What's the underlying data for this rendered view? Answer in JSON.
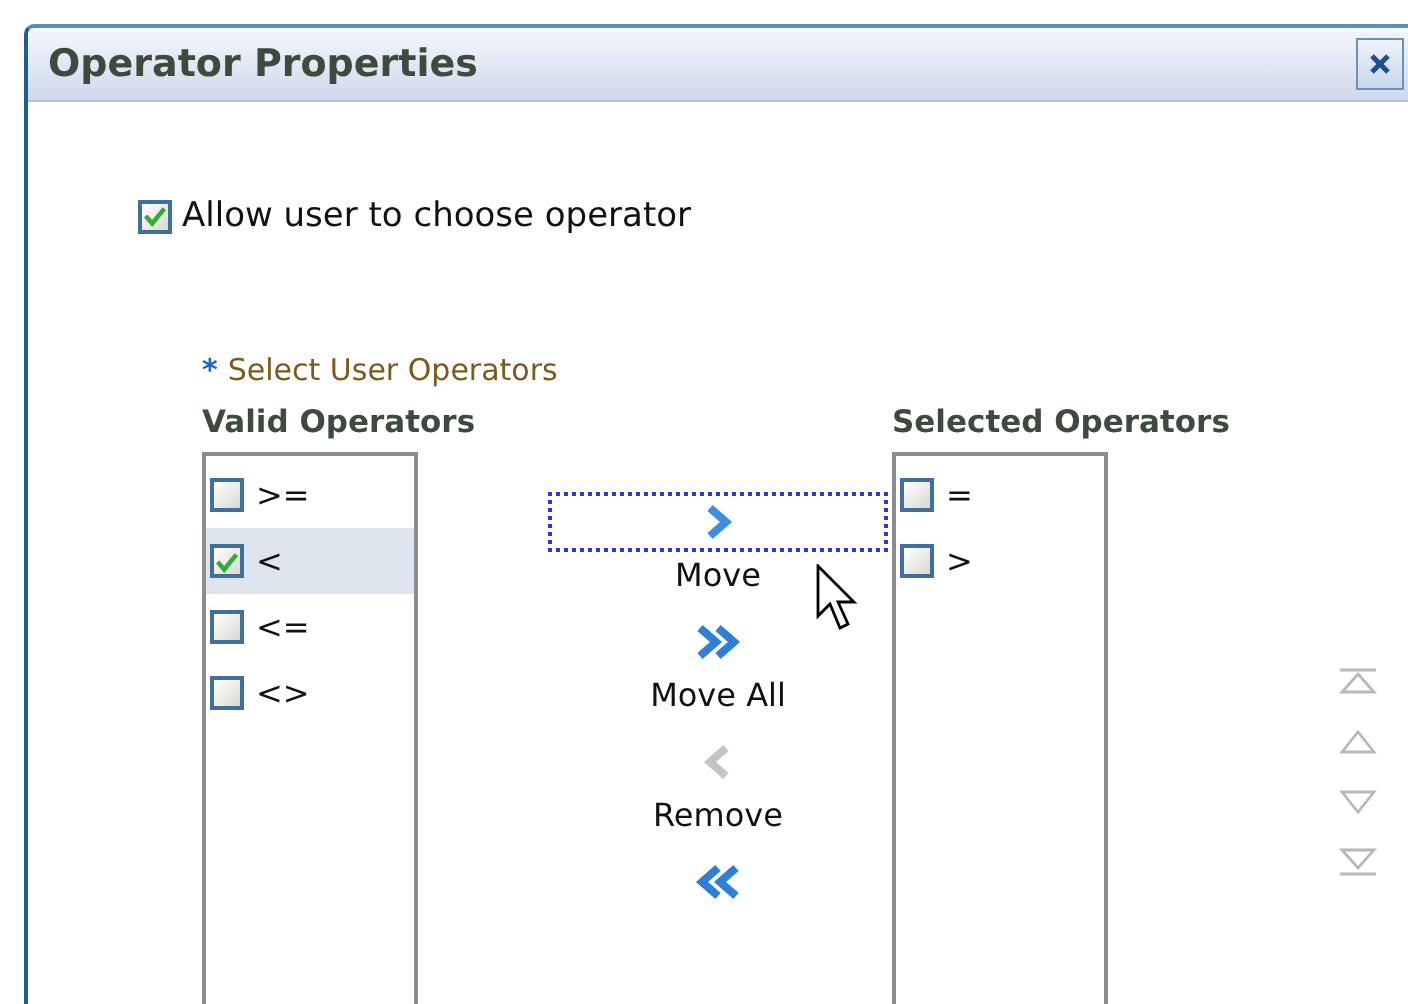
{
  "window": {
    "title": "Operator Properties"
  },
  "allow_choose": {
    "label": "Allow user to choose operator",
    "checked": true
  },
  "required_label": {
    "marker": "*",
    "text": "Select User Operators"
  },
  "valid_operators": {
    "heading": "Valid Operators",
    "items": [
      {
        "label": ">=",
        "checked": false,
        "selected": false
      },
      {
        "label": "<",
        "checked": true,
        "selected": true
      },
      {
        "label": "<=",
        "checked": false,
        "selected": false
      },
      {
        "label": "<>",
        "checked": false,
        "selected": false
      }
    ]
  },
  "shuttle_buttons": [
    {
      "kind": "move",
      "label": "Move",
      "focused": true
    },
    {
      "kind": "move_all",
      "label": "Move All",
      "focused": false
    },
    {
      "kind": "remove",
      "label": "Remove",
      "focused": false
    },
    {
      "kind": "remove_all",
      "focused": false
    }
  ],
  "selected_operators": {
    "heading": "Selected Operators",
    "items": [
      {
        "label": "=",
        "checked": false,
        "selected": false
      },
      {
        "label": ">",
        "checked": false,
        "selected": false
      }
    ]
  }
}
